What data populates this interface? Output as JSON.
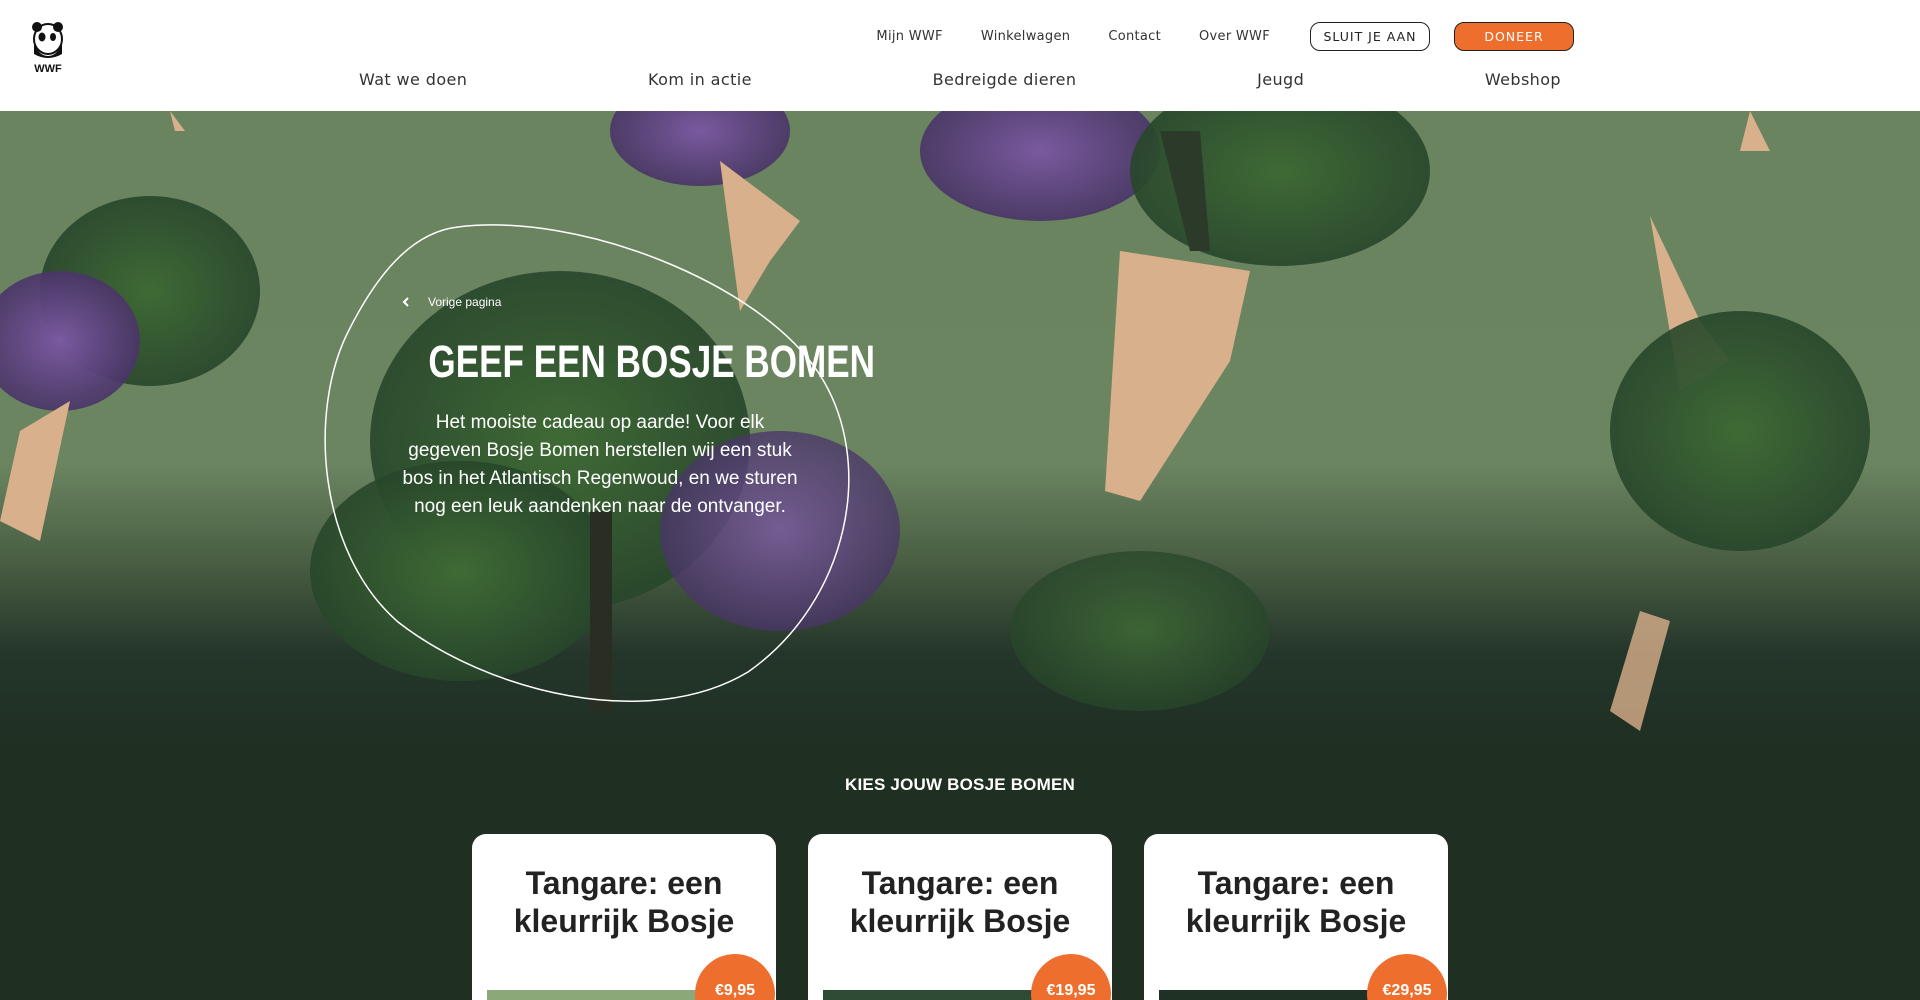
{
  "brand": {
    "logo_text": "WWF",
    "accent": "#ee6f2d"
  },
  "utility_nav": {
    "links": [
      "Mijn WWF",
      "Winkelwagen",
      "Contact",
      "Over WWF"
    ],
    "join_label": "SLUIT JE AAN",
    "donate_label": "DONEER"
  },
  "main_nav": [
    "Wat we doen",
    "Kom in actie",
    "Bedreigde dieren",
    "Jeugd",
    "Webshop"
  ],
  "hero": {
    "back_label": "Vorige pagina",
    "title": "GEEF EEN BOSJE BOMEN",
    "text": "Het mooiste cadeau op aarde! Voor elk gegeven Bosje Bomen herstellen wij een stuk bos in het Atlantisch Regenwoud, en we sturen nog een leuk aandenken naar de ontvanger."
  },
  "products": {
    "heading": "KIES JOUW BOSJE BOMEN",
    "items": [
      {
        "title": "Tangare: een kleurrijk Bosje",
        "price": "€9,95"
      },
      {
        "title": "Tangare: een kleurrijk Bosje",
        "price": "€19,95"
      },
      {
        "title": "Tangare: een kleurrijk Bosje",
        "price": "€29,95"
      }
    ]
  }
}
